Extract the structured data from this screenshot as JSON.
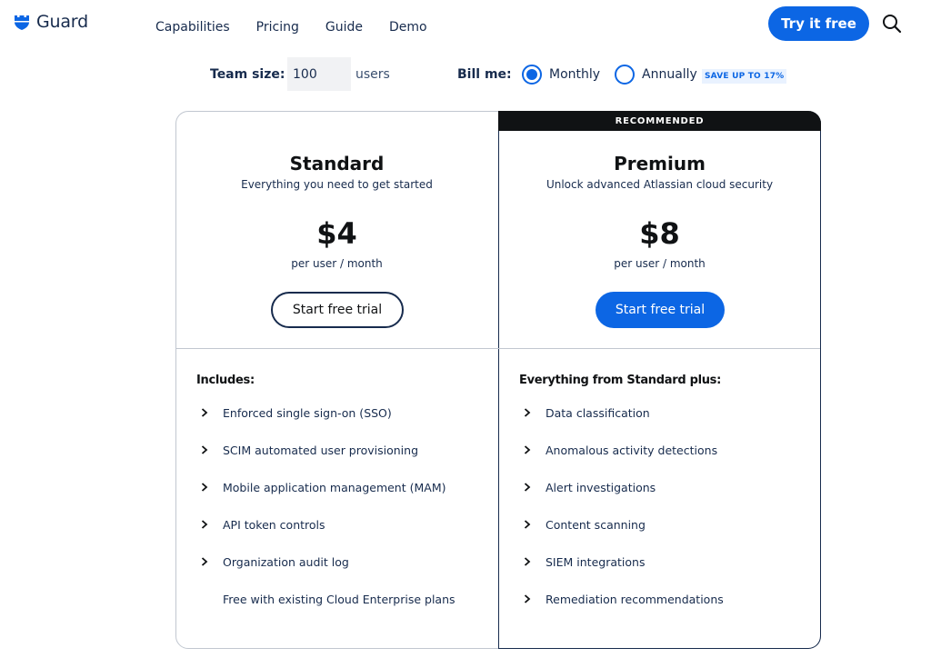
{
  "header": {
    "brand": "Guard",
    "nav": [
      "Capabilities",
      "Pricing",
      "Guide",
      "Demo"
    ],
    "cta": "Try it free",
    "brand_color": "#0c66e4"
  },
  "controls": {
    "team_label": "Team size:",
    "team_value": "100",
    "users_label": "users",
    "bill_label": "Bill me:",
    "monthly_label": "Monthly",
    "annual_label": "Annually",
    "save_badge": "SAVE UP TO 17%",
    "selected": "Monthly"
  },
  "plans": {
    "standard": {
      "name": "Standard",
      "description": "Everything you need to get started",
      "price": "$4",
      "unit": "per user / month",
      "button": "Start free trial",
      "features_heading": "Includes:",
      "features": [
        "Enforced single sign-on (SSO)",
        "SCIM automated user provisioning",
        "Mobile application management (MAM)",
        "API token controls",
        "Organization audit log"
      ],
      "note": "Free with existing Cloud Enterprise plans"
    },
    "premium": {
      "banner": "RECOMMENDED",
      "name": "Premium",
      "description": "Unlock advanced Atlassian cloud security",
      "price": "$8",
      "unit": "per user / month",
      "button": "Start free trial",
      "features_heading": "Everything from Standard plus:",
      "features": [
        "Data classification",
        "Anomalous activity detections",
        "Alert investigations",
        "Content scanning",
        "SIEM integrations",
        "Remediation recommendations"
      ]
    }
  }
}
